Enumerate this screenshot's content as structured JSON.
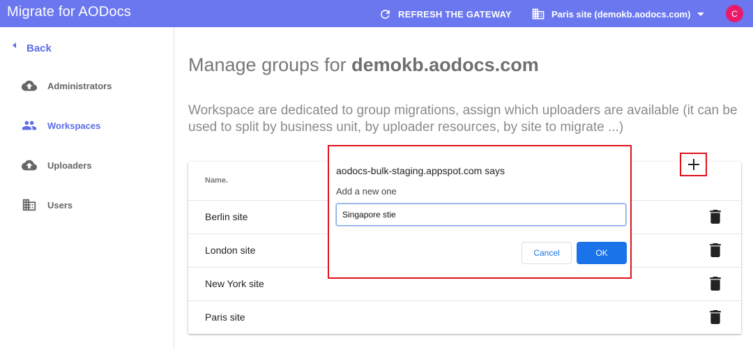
{
  "app": {
    "title": "Migrate for AODocs"
  },
  "header": {
    "refresh_label": "REFRESH THE GATEWAY",
    "site_label": "Paris site (demokb.aodocs.com)",
    "avatar_letter": "C"
  },
  "sidebar": {
    "back_label": "Back",
    "items": [
      {
        "label": "Administrators",
        "icon": "cloud-upload-icon"
      },
      {
        "label": "Workspaces",
        "icon": "group-icon",
        "active": true
      },
      {
        "label": "Uploaders",
        "icon": "cloud-upload-icon"
      },
      {
        "label": "Users",
        "icon": "building-icon"
      }
    ]
  },
  "main": {
    "title_prefix": "Manage groups for ",
    "title_domain": "demokb.aodocs.com",
    "description": "Workspace are dedicated to group migrations, assign which uploaders are available (it can be used to split by business unit, by uploader resources, by site to migrate ...)",
    "table": {
      "column_header": "Name.",
      "rows": [
        "Berlin site",
        "London site",
        "New York site",
        "Paris site"
      ]
    }
  },
  "dialog": {
    "title": "aodocs-bulk-staging.appspot.com says",
    "message": "Add a new one",
    "input_value": "Singapore stie",
    "cancel_label": "Cancel",
    "ok_label": "OK"
  },
  "colors": {
    "topbar": "#6a77ee",
    "accent": "#5c6de8",
    "avatar": "#ea1a6b",
    "highlight_border": "#e0101a",
    "dialog_primary": "#1a73e8"
  }
}
